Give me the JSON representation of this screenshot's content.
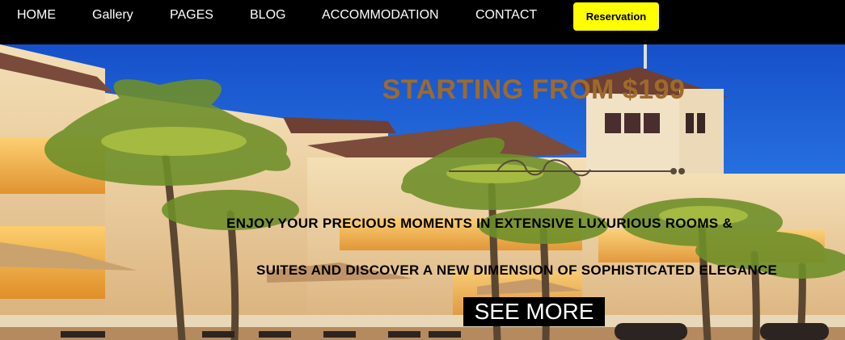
{
  "nav": {
    "items": [
      {
        "label": "HOME"
      },
      {
        "label": "Gallery"
      },
      {
        "label": "PAGES"
      },
      {
        "label": "BLOG"
      },
      {
        "label": "ACCOMMODATION"
      },
      {
        "label": "CONTACT"
      }
    ],
    "reservation_label": "Reservation"
  },
  "hero": {
    "headline": "STARTING FROM $199",
    "tagline_line1": "ENJOY YOUR PRECIOUS MOMENTS IN EXTENSIVE LUXURIOUS ROOMS &",
    "tagline_line2": "SUITES AND DISCOVER A NEW DIMENSION OF SOPHISTICATED ELEGANCE",
    "cta_label": "SEE MORE",
    "background_image": "resort-hotel-night-icon"
  },
  "colors": {
    "nav_bg": "#000000",
    "reservation_bg": "#ffff00",
    "headline": "#9e6a2b",
    "sky": "#1e5fd6"
  }
}
